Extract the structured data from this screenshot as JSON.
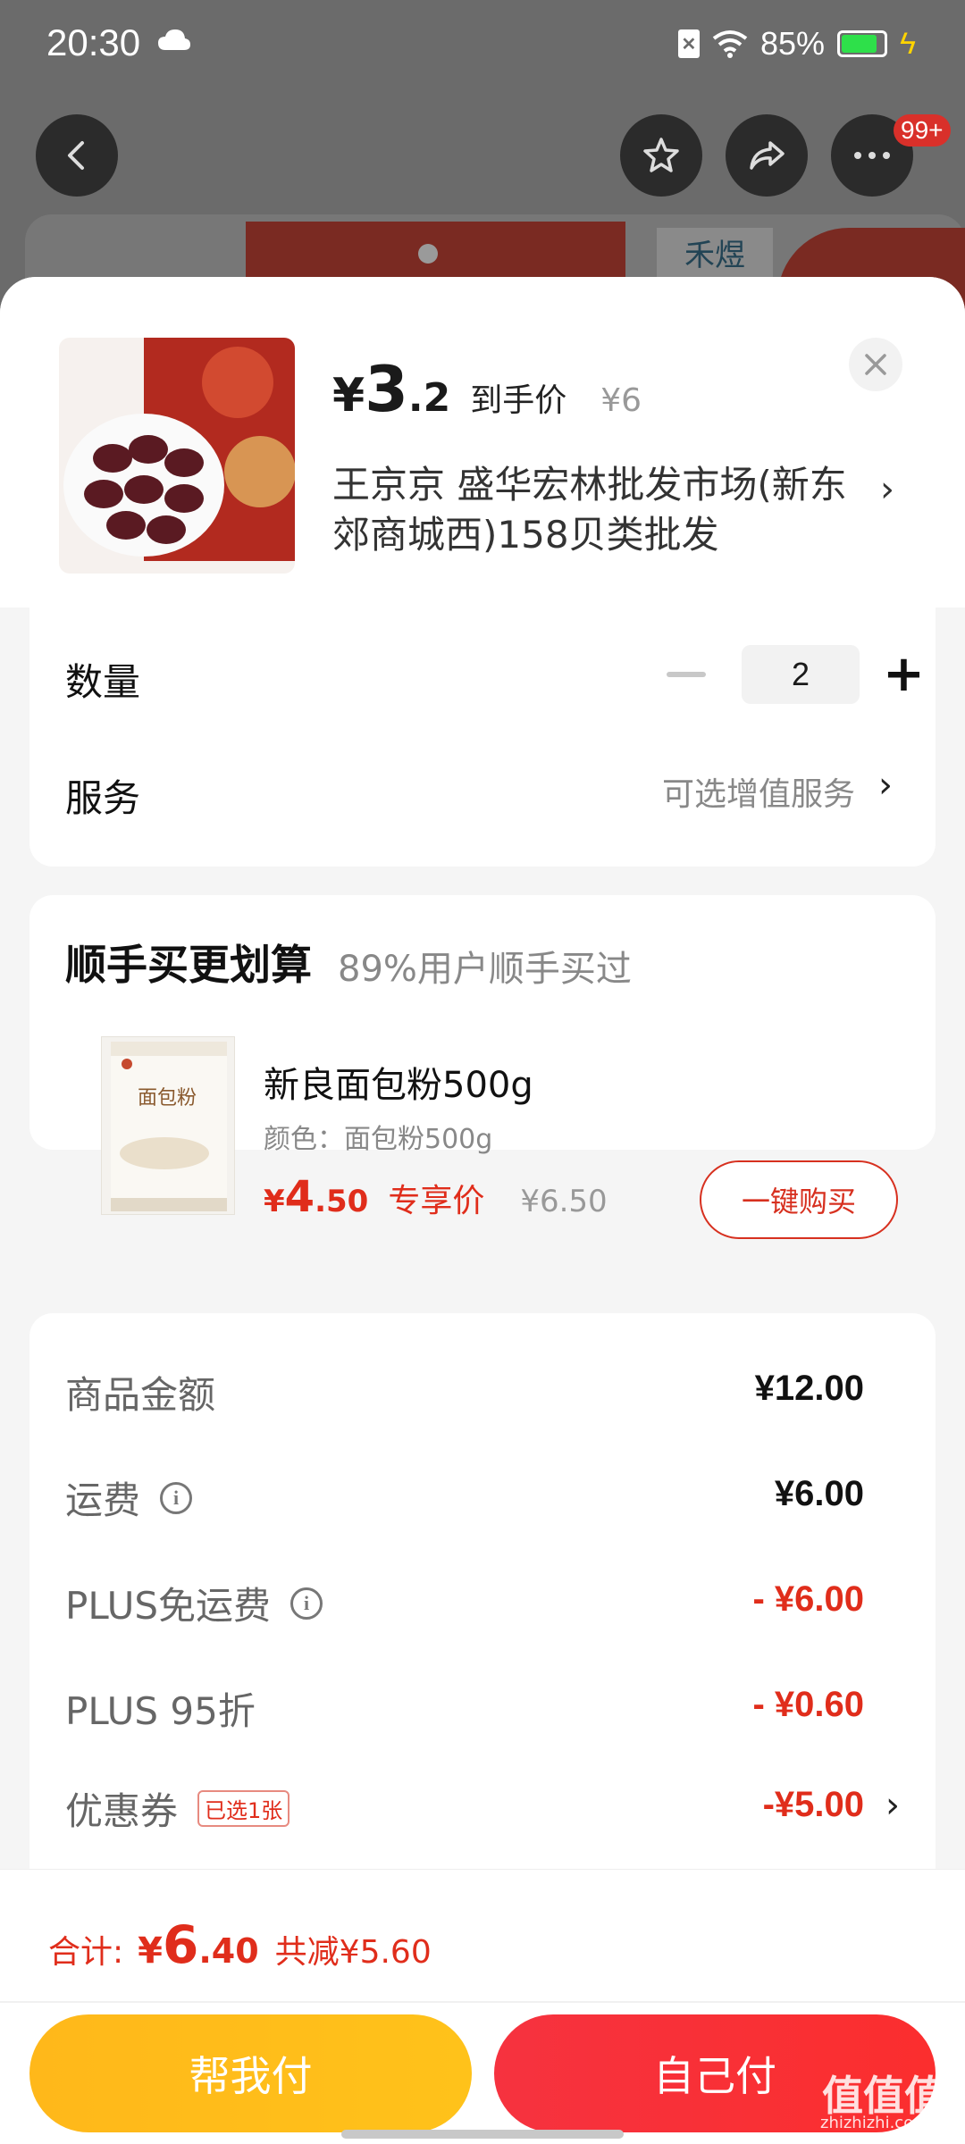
{
  "status_bar": {
    "time": "20:30",
    "battery": "85%",
    "battery_level": 0.85,
    "icons": [
      "cloud-icon",
      "sim-off-icon",
      "wifi-icon",
      "battery-icon",
      "charging-bolt-icon"
    ]
  },
  "top_nav": {
    "icons": [
      "back-icon",
      "star-icon",
      "share-icon",
      "more-icon"
    ],
    "badge": "99+"
  },
  "background": {
    "logo_text": "禾煜"
  },
  "product": {
    "price_yen": "¥",
    "price_int": "3",
    "price_dec": ".2",
    "price_label": "到手价",
    "original_price": "¥6",
    "shop_name": "王京京  盛华宏林批发市场(新东郊商城西)158贝类批发",
    "shop_chevron": "›"
  },
  "quantity": {
    "label": "数量",
    "value": "2",
    "minus": "−",
    "plus": "+"
  },
  "service": {
    "label": "服务",
    "value": "可选增值服务",
    "chevron": "›"
  },
  "addon": {
    "title": "顺手买更划算",
    "subtitle": "89%用户顺手买过",
    "image_text": "面包粉",
    "name": "新良面包粉500g",
    "spec": "颜色：面包粉500g",
    "price_yen": "¥",
    "price_int": "4",
    "price_dec": ".50",
    "price_tag": "专享价",
    "original_price": "¥6.50",
    "buy_label": "一键购买"
  },
  "summary": {
    "rows": [
      {
        "label": "商品金额",
        "value": "¥12.00"
      },
      {
        "label": "运费",
        "value": "¥6.00"
      },
      {
        "label": "PLUS免运费",
        "value": "- ¥6.00"
      },
      {
        "label": "PLUS 95折",
        "value": "- ¥0.60"
      },
      {
        "label": "优惠券",
        "badge": "已选1张",
        "value": "-¥5.00",
        "chevron": "›"
      }
    ],
    "info_glyph": "i"
  },
  "bottom": {
    "total_label": "合计:",
    "total_yen": "¥",
    "total_int": "6",
    "total_dec": ".40",
    "savings": "共减¥5.60",
    "help_pay": "帮我付",
    "self_pay": "自己付"
  },
  "watermark": {
    "main": "值值值",
    "sub": "zhizhizhi.com"
  },
  "colors": {
    "accent_red": "#e02d1b",
    "help_pay": "#ffbb1a",
    "self_pay": "#f6323f",
    "battery_green": "#2ee04a"
  }
}
